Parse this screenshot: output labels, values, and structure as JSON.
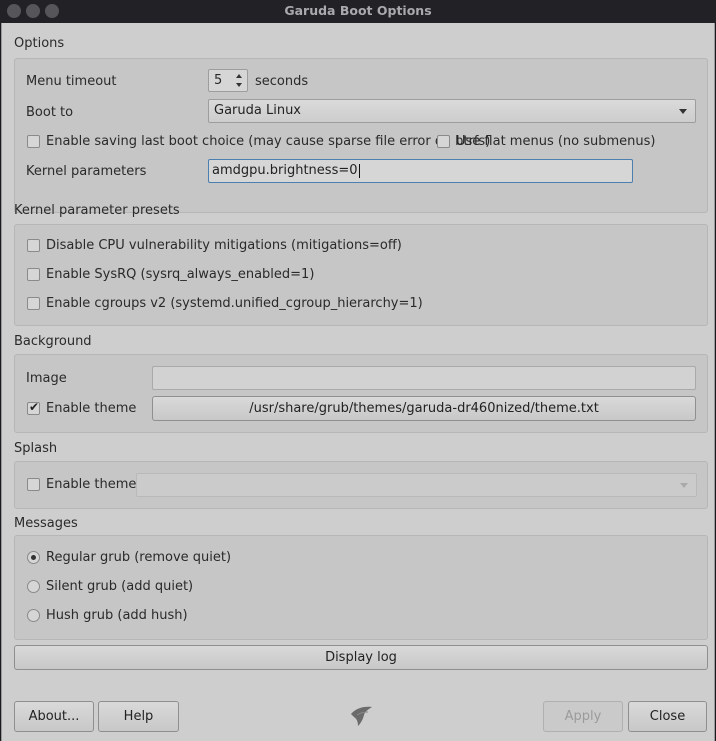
{
  "window": {
    "title": "Garuda Boot Options"
  },
  "sections": {
    "options": "Options",
    "kernel_presets": "Kernel parameter presets",
    "background": "Background",
    "splash": "Splash",
    "messages": "Messages"
  },
  "options": {
    "menu_timeout_label": "Menu timeout",
    "menu_timeout_value": "5",
    "menu_timeout_unit": "seconds",
    "boot_to_label": "Boot to",
    "boot_to_value": "Garuda Linux",
    "save_last_label": "Enable saving last boot choice (may cause sparse file error on btrfs)",
    "save_last_checked": false,
    "flat_menus_label": "Use flat menus (no submenus)",
    "flat_menus_checked": false,
    "kernel_params_label": "Kernel parameters",
    "kernel_params_value": "amdgpu.brightness=0"
  },
  "presets": [
    {
      "label": "Disable CPU vulnerability mitigations (mitigations=off)",
      "checked": false
    },
    {
      "label": "Enable SysRQ (sysrq_always_enabled=1)",
      "checked": false
    },
    {
      "label": "Enable cgroups v2 (systemd.unified_cgroup_hierarchy=1)",
      "checked": false
    }
  ],
  "background": {
    "image_label": "Image",
    "image_value": "",
    "theme_label": "Enable theme",
    "theme_checked": true,
    "theme_path": "/usr/share/grub/themes/garuda-dr460nized/theme.txt"
  },
  "splash": {
    "theme_label": "Enable theme",
    "theme_checked": false,
    "theme_value": ""
  },
  "messages": [
    {
      "label": "Regular grub (remove quiet)",
      "selected": true
    },
    {
      "label": "Silent grub (add quiet)",
      "selected": false
    },
    {
      "label": "Hush grub (add hush)",
      "selected": false
    }
  ],
  "buttons": {
    "display_log": "Display log",
    "about": "About...",
    "help": "Help",
    "apply": "Apply",
    "close": "Close"
  },
  "icons": {
    "app_logo": "garuda-eagle-icon"
  }
}
